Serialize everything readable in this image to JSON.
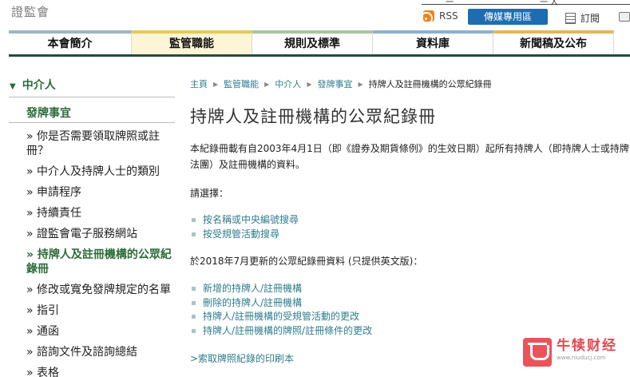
{
  "header": {
    "logo_text": "證監會",
    "rss_label": "RSS",
    "media_button": "傳媒專用區",
    "subscribe_label": "訂閱",
    "top_fragments": [
      "一",
      "一 人"
    ]
  },
  "nav": {
    "items": [
      {
        "label": "本會簡介",
        "color": "#9ab7c0",
        "width": 154
      },
      {
        "label": "監管職能",
        "color": "#e8c95a",
        "width": 151
      },
      {
        "label": "規則及標準",
        "color": "#a9c4a0",
        "width": 151
      },
      {
        "label": "資料庫",
        "color": "#8fb0cc",
        "width": 151
      },
      {
        "label": "新聞稿及公布",
        "color": "#e0b85a",
        "width": 151
      }
    ],
    "active_index": 1
  },
  "sidebar": {
    "heading": "中介人",
    "subheading": "發牌事宜",
    "items": [
      {
        "label": "» 你是否需要領取牌照或註冊？",
        "current": false
      },
      {
        "label": "» 中介人及持牌人士的類別",
        "current": false
      },
      {
        "label": "» 申請程序",
        "current": false
      },
      {
        "label": "» 持續責任",
        "current": false
      },
      {
        "label": "» 證監會電子服務網站",
        "current": false
      },
      {
        "label": "» 持牌人及註冊機構的公眾紀錄冊",
        "current": true
      },
      {
        "label": "» 修改或寬免發牌規定的名單",
        "current": false
      },
      {
        "label": "» 指引",
        "current": false
      },
      {
        "label": "» 通函",
        "current": false
      },
      {
        "label": "» 諮詢文件及諮詢總結",
        "current": false
      },
      {
        "label": "» 表格",
        "current": false
      }
    ]
  },
  "breadcrumb": [
    "主頁",
    "監管職能",
    "中介人",
    "發牌事宜",
    "持牌人及註冊機構的公眾紀錄冊"
  ],
  "content": {
    "title": "持牌人及註冊機構的公眾紀錄冊",
    "intro": "本紀錄冊載有自2003年4月1日（即《證券及期貨條例》的生效日期）起所有持牌人（即持牌人士或持牌法團）及註冊機構的資料。",
    "prompt": "請選擇：",
    "search_links": [
      "按名稱或中央編號搜尋",
      "按受規管活動搜尋"
    ],
    "updated_text": "於2018年7月更新的公眾紀錄冊資料 (只提供英文版)：",
    "update_links": [
      "新增的持牌人/註冊機構",
      "刪除的持牌人/註冊機構",
      "持牌人/註冊機構的受規管活動的更改",
      "持牌人/註冊機構的牌照/註冊條件的更改"
    ],
    "print_link": ">索取牌照紀錄的印刷本"
  },
  "watermark": {
    "text": "牛犊财经",
    "url": "www.niuducj.com"
  }
}
